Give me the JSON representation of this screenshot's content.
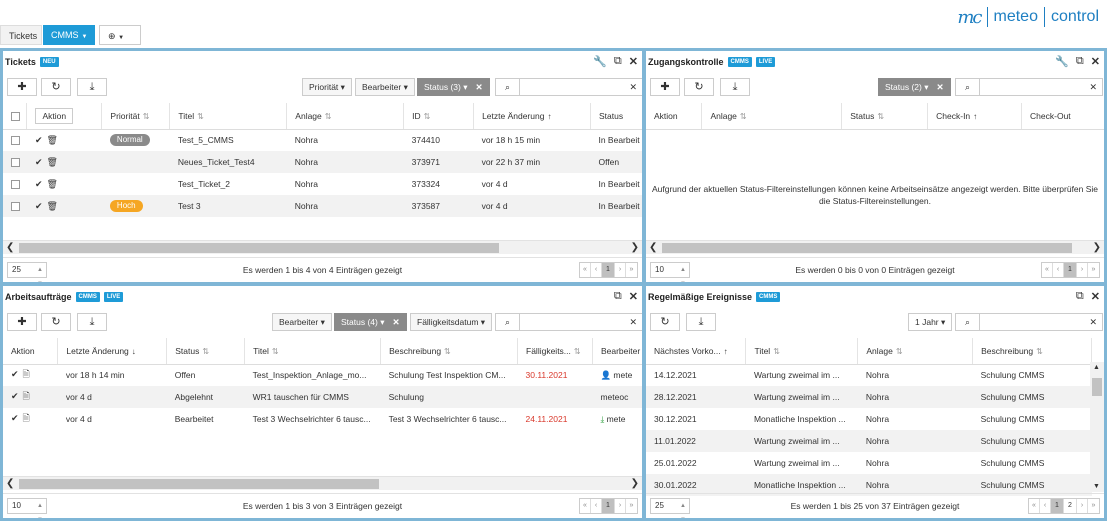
{
  "topbar": {
    "tabs": [
      "Tickets",
      "CMMS"
    ],
    "add_icon": "plus-circle-icon",
    "logo": {
      "mark": "mc",
      "word1": "meteo",
      "word2": "control"
    }
  },
  "colors": {
    "accent": "#1e9bd7",
    "panel_border": "#7fb6d6",
    "priority_normal": "#8a8a8a",
    "priority_high": "#f5a623",
    "overdue": "#d9382b"
  },
  "tickets": {
    "title": "Tickets",
    "badges": [
      "NEU"
    ],
    "filters": {
      "priority": "Priorität",
      "editor": "Bearbeiter",
      "status": "Status (3)"
    },
    "columns": [
      "Aktion",
      "Priorität",
      "Titel",
      "Anlage",
      "ID",
      "Letzte Änderung",
      "Status"
    ],
    "rows": [
      {
        "priority": "Normal",
        "title": "Test_5_CMMS",
        "plant": "Nohra",
        "id": "374410",
        "changed": "vor 18 h 15 min",
        "status": "In Bearbeit"
      },
      {
        "priority": "",
        "title": "Neues_Ticket_Test4",
        "plant": "Nohra",
        "id": "373971",
        "changed": "vor 22 h 37 min",
        "status": "Offen"
      },
      {
        "priority": "",
        "title": "Test_Ticket_2",
        "plant": "Nohra",
        "id": "373324",
        "changed": "vor 4 d",
        "status": "In Bearbeit"
      },
      {
        "priority": "Hoch",
        "title": "Test 3",
        "plant": "Nohra",
        "id": "373587",
        "changed": "vor 4 d",
        "status": "In Bearbeit"
      }
    ],
    "page_size": "25",
    "info": "Es werden 1 bis 4 von 4 Einträgen gezeigt",
    "pages": [
      "1"
    ]
  },
  "access": {
    "title": "Zugangskontrolle",
    "badges": [
      "CMMS",
      "LIVE"
    ],
    "filters": {
      "status": "Status (2)"
    },
    "columns": [
      "Aktion",
      "Anlage",
      "Status",
      "Check-In",
      "Check-Out"
    ],
    "empty": "Aufgrund der aktuellen Status-Filtereinstellungen können keine Arbeitseinsätze angezeigt werden. Bitte überprüfen Sie die Status-Filtereinstellungen.",
    "page_size": "10",
    "info": "Es werden 0 bis 0 von 0 Einträgen gezeigt",
    "pages": [
      "1"
    ]
  },
  "workorders": {
    "title": "Arbeitsaufträge",
    "badges": [
      "CMMS",
      "LIVE"
    ],
    "filters": {
      "editor": "Bearbeiter",
      "status": "Status (4)",
      "due": "Fälligkeitsdatum"
    },
    "columns": [
      "Aktion",
      "Letzte Änderung",
      "Status",
      "Titel",
      "Beschreibung",
      "Fälligkeits...",
      "Bearbeiter"
    ],
    "rows": [
      {
        "changed": "vor 18 h 14 min",
        "status": "Offen",
        "title": "Test_Inspektion_Anlage_mo...",
        "desc": "Schulung Test Inspektion CM...",
        "due": "30.11.2021",
        "overdue": true,
        "editor": "mete"
      },
      {
        "changed": "vor 4 d",
        "status": "Abgelehnt",
        "title": "WR1 tauschen für CMMS",
        "desc": "Schulung",
        "due": "",
        "overdue": false,
        "editor": "meteoc"
      },
      {
        "changed": "vor 4 d",
        "status": "Bearbeitet",
        "title": "Test 3 Wechselrichter 6 tausc...",
        "desc": "Test 3 Wechselrichter 6 tausc...",
        "due": "24.11.2021",
        "overdue": true,
        "editor": "mete"
      }
    ],
    "page_size": "10",
    "info": "Es werden 1 bis 3 von 3 Einträgen gezeigt",
    "pages": [
      "1"
    ]
  },
  "events": {
    "title": "Regelmäßige Ereignisse",
    "badges": [
      "CMMS"
    ],
    "filters": {
      "range": "1 Jahr"
    },
    "columns": [
      "Nächstes Vorko...",
      "Titel",
      "Anlage",
      "Beschreibung"
    ],
    "rows": [
      {
        "date": "14.12.2021",
        "title": "Wartung zweimal im ...",
        "plant": "Nohra",
        "desc": "Schulung CMMS"
      },
      {
        "date": "28.12.2021",
        "title": "Wartung zweimal im ...",
        "plant": "Nohra",
        "desc": "Schulung CMMS"
      },
      {
        "date": "30.12.2021",
        "title": "Monatliche Inspektion ...",
        "plant": "Nohra",
        "desc": "Schulung CMMS"
      },
      {
        "date": "11.01.2022",
        "title": "Wartung zweimal im ...",
        "plant": "Nohra",
        "desc": "Schulung CMMS"
      },
      {
        "date": "25.01.2022",
        "title": "Wartung zweimal im ...",
        "plant": "Nohra",
        "desc": "Schulung CMMS"
      },
      {
        "date": "30.01.2022",
        "title": "Monatliche Inspektion ...",
        "plant": "Nohra",
        "desc": "Schulung CMMS"
      }
    ],
    "page_size": "25",
    "info": "Es werden 1 bis 25 von 37 Einträgen gezeigt",
    "pages": [
      "1",
      "2"
    ]
  }
}
